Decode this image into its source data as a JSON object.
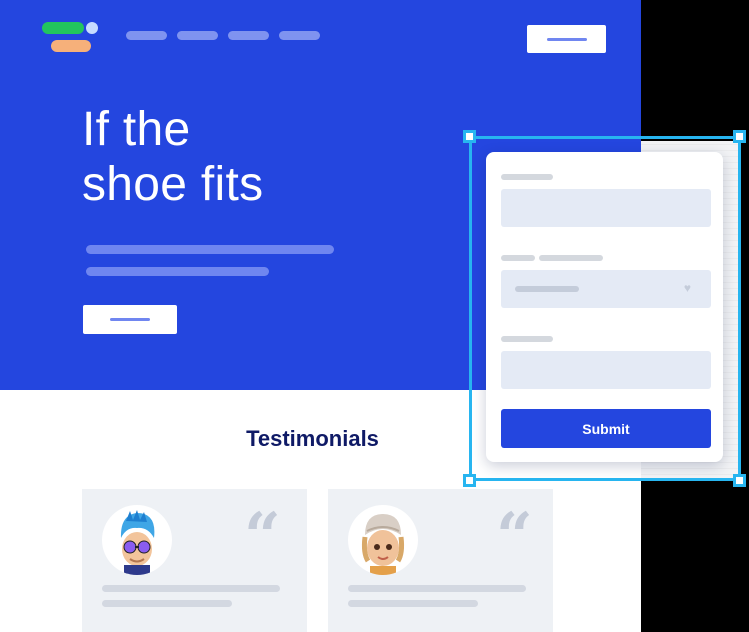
{
  "hero": {
    "title": "If the\nshoe fits"
  },
  "testimonials": {
    "title": "Testimonials",
    "quote_glyph": "“"
  },
  "form": {
    "submit_label": "Submit",
    "select_arrow": "♥"
  },
  "colors": {
    "brand_blue": "#2446df",
    "selection_cyan": "#27b5f0",
    "heading_navy": "#0f1a66"
  },
  "icons": {
    "logo": "brand-logo-icon",
    "avatar1": "avatar-blue-hair-icon",
    "avatar2": "avatar-cap-icon",
    "quote": "quote-icon",
    "select": "chevron-down-icon"
  }
}
